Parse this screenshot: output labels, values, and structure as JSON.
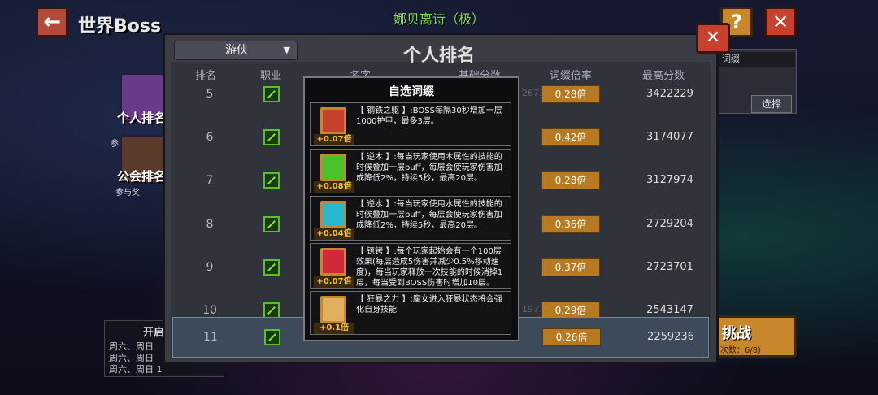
{
  "header": {
    "back_icon": "←",
    "title": "世界Boss",
    "boss_name": "娜贝离诗（极）",
    "help_icon": "?",
    "close_icon": "✕"
  },
  "side_tabs": [
    {
      "label": "个人排名",
      "sub": "参"
    },
    {
      "label": "公会排名",
      "sub": "参与奖"
    }
  ],
  "right_panel": {
    "field_text": "词缀",
    "select_label": "选择",
    "challenge_label": "挑战",
    "challenge_count": "次数：6/8)"
  },
  "open_info": {
    "title": "开启",
    "lines": [
      "周六、周日",
      "周六、周日",
      "周六、周日 1"
    ]
  },
  "ranking": {
    "title": "个人排名",
    "class_filter": "游侠",
    "close_icon": "✕",
    "columns": [
      "排名",
      "职业",
      "名字",
      "基础分数",
      "词缀倍率",
      "最高分数"
    ],
    "rows": [
      {
        "rank": "5",
        "base": "2673617",
        "mult": "0.28倍",
        "max": "3422229",
        "hl": false
      },
      {
        "rank": "6",
        "base": "",
        "mult": "0.42倍",
        "max": "3174077",
        "hl": false
      },
      {
        "rank": "7",
        "base": "",
        "mult": "0.28倍",
        "max": "3127974",
        "hl": false
      },
      {
        "rank": "8",
        "base": "",
        "mult": "0.36倍",
        "max": "2729204",
        "hl": false
      },
      {
        "rank": "9",
        "base": "",
        "mult": "0.37倍",
        "max": "2723701",
        "hl": false
      },
      {
        "rank": "10",
        "base": "1971612",
        "mult": "0.29倍",
        "max": "2543147",
        "hl": false
      },
      {
        "rank": "11",
        "base": "",
        "mult": "0.26倍",
        "max": "2259236",
        "hl": true
      }
    ]
  },
  "affix_modal": {
    "title": "自选词缀",
    "affixes": [
      {
        "name": "钢铁之躯",
        "text": "【 钢铁之躯 】:BOSS每隔30秒增加一层1000护甲，最多3层。",
        "bonus": "+0.07倍",
        "icon": "demon-face-icon",
        "color": "#c8412e"
      },
      {
        "name": "逆木",
        "text": "【 逆木 】:每当玩家使用木属性的技能的时候叠加一层buff，每层会使玩家伤害加成降低2%，持续5秒，最高20层。",
        "bonus": "+0.08倍",
        "icon": "green-wing-icon",
        "color": "#4ac02a"
      },
      {
        "name": "逆水",
        "text": "【 逆水 】:每当玩家使用水属性的技能的时候叠加一层buff，每层会使玩家伤害加成降低2%，持续5秒，最高20层。",
        "bonus": "+0.04倍",
        "icon": "blue-wing-icon",
        "color": "#2ab8d0"
      },
      {
        "name": "镣铐",
        "text": "【 镣铐 】:每个玩家起始会有一个100层效果(每层造成5伤害并减少0.5%移动速度)，每当玩家释放一次技能的时候消掉1层，每当受到BOSS伤害时增加10层。",
        "bonus": "+0.07倍",
        "icon": "down-arrow-icon",
        "color": "#d02a3a"
      },
      {
        "name": "狂暴之力",
        "text": "【 狂暴之力 】:魔女进入狂暴状态将会强化自身技能",
        "bonus": "+0.1倍",
        "icon": "rage-face-icon",
        "color": "#e0b060"
      }
    ]
  }
}
